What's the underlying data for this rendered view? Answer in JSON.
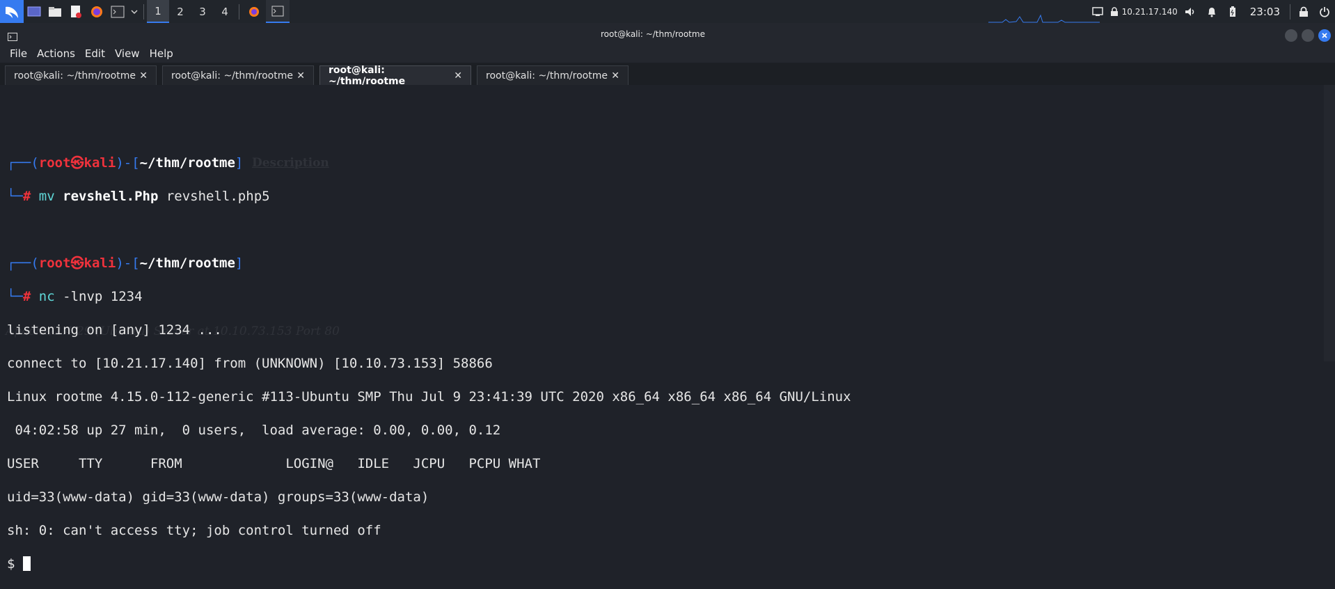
{
  "taskbar": {
    "workspaces": [
      "1",
      "2",
      "3",
      "4"
    ],
    "active_workspace": "1",
    "ip": "10.21.17.140",
    "clock": "23:03"
  },
  "window": {
    "title": "root@kali: ~/thm/rootme",
    "menu": [
      "File",
      "Actions",
      "Edit",
      "View",
      "Help"
    ],
    "tabs": [
      {
        "label": "root@kali: ~/thm/rootme",
        "active": false
      },
      {
        "label": "root@kali: ~/thm/rootme",
        "active": false
      },
      {
        "label": "root@kali: ~/thm/rootme",
        "active": true
      },
      {
        "label": "root@kali: ~/thm/rootme",
        "active": false
      }
    ],
    "tab_close_glyph": "✕"
  },
  "terminal": {
    "prompt_user": "root",
    "prompt_at": "㉿",
    "prompt_host": "kali",
    "prompt_dir": "~/thm/rootme",
    "prompt_hash": "#",
    "cmd1_name": "mv",
    "cmd1_arg1": "revshell.Php",
    "cmd1_arg2": " revshell.php5",
    "cmd2_name": "nc",
    "cmd2_args": " -lnvp 1234",
    "output": [
      "listening on [any] 1234 ...",
      "connect to [10.21.17.140] from (UNKNOWN) [10.10.73.153] 58866",
      "Linux rootme 4.15.0-112-generic #113-Ubuntu SMP Thu Jul 9 23:41:39 UTC 2020 x86_64 x86_64 x86_64 GNU/Linux",
      " 04:02:58 up 27 min,  0 users,  load average: 0.00, 0.00, 0.12",
      "USER     TTY      FROM             LOGIN@   IDLE   JCPU   PCPU WHAT",
      "uid=33(www-data) gid=33(www-data) groups=33(www-data)",
      "sh: 0: can't access tty; job control turned off"
    ],
    "shell_prompt": "$ "
  },
  "background_ghost": {
    "footer": "Apache/2.4.29 (Ubuntu) Server at 10.10.73.153 Port 80",
    "description": "Description"
  },
  "colors": {
    "accent": "#367bf0",
    "prompt_red": "#f0323c",
    "command_cyan": "#5fd7d7",
    "terminal_bg": "#1f2229"
  }
}
